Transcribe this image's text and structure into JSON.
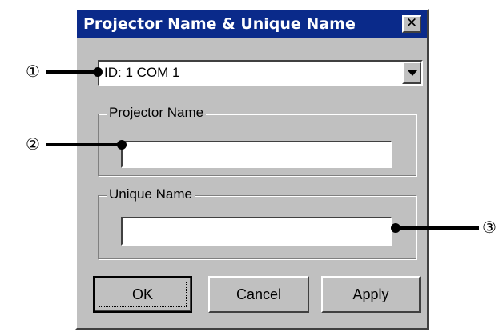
{
  "dialog": {
    "title": "Projector Name & Unique Name",
    "close_glyph": "✕"
  },
  "id_select": {
    "value": "ID:  1 COM 1"
  },
  "projector_group": {
    "label": "Projector Name",
    "value": ""
  },
  "unique_group": {
    "label": "Unique Name",
    "value": ""
  },
  "buttons": {
    "ok": "OK",
    "cancel": "Cancel",
    "apply": "Apply"
  },
  "callouts": [
    "①",
    "②",
    "③"
  ],
  "icons": {
    "close": "close-icon",
    "dropdown": "chevron-down-icon"
  },
  "colors": {
    "titlebar": "#0a2a8a",
    "face": "#c0c0c0"
  }
}
